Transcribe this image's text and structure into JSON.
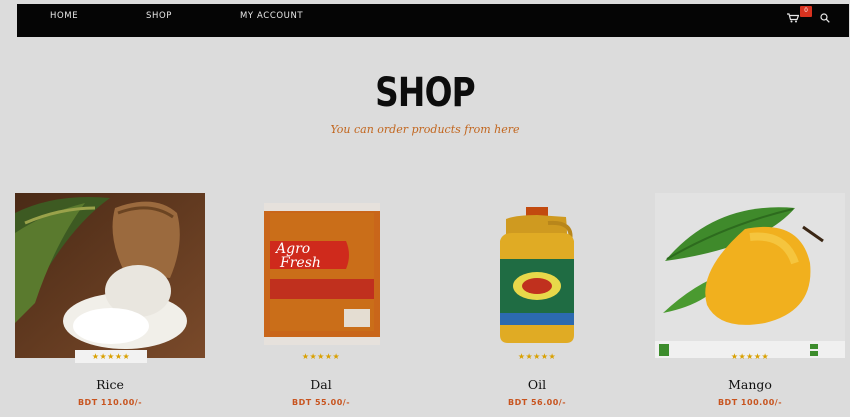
{
  "nav": {
    "links": [
      "HOME",
      "SHOP",
      "MY ACCOUNT"
    ],
    "cart_count": "0",
    "cart_icon": "shopping-cart-icon",
    "search_icon": "search-icon"
  },
  "hero": {
    "title": "SHOP",
    "subtitle": "You can order products from here"
  },
  "products": [
    {
      "name": "Rice",
      "price": "BDT 110.00/-",
      "rating": "★★★★★",
      "image": "rice-sack-image"
    },
    {
      "name": "Dal",
      "price": "BDT 55.00/-",
      "rating": "★★★★★",
      "image": "agro-fresh-dal-pack-image",
      "pack_brand": "Agro",
      "pack_brand2": "Fresh"
    },
    {
      "name": "Oil",
      "price": "BDT 56.00/-",
      "rating": "★★★★★",
      "image": "oil-bottle-image"
    },
    {
      "name": "Mango",
      "price": "BDT 100.00/-",
      "rating": "★★★★★",
      "image": "mango-image"
    }
  ],
  "colors": {
    "nav_bg": "#050505",
    "accent": "#c8541f",
    "star": "#d9a000",
    "page_bg": "#dcdcdc"
  }
}
